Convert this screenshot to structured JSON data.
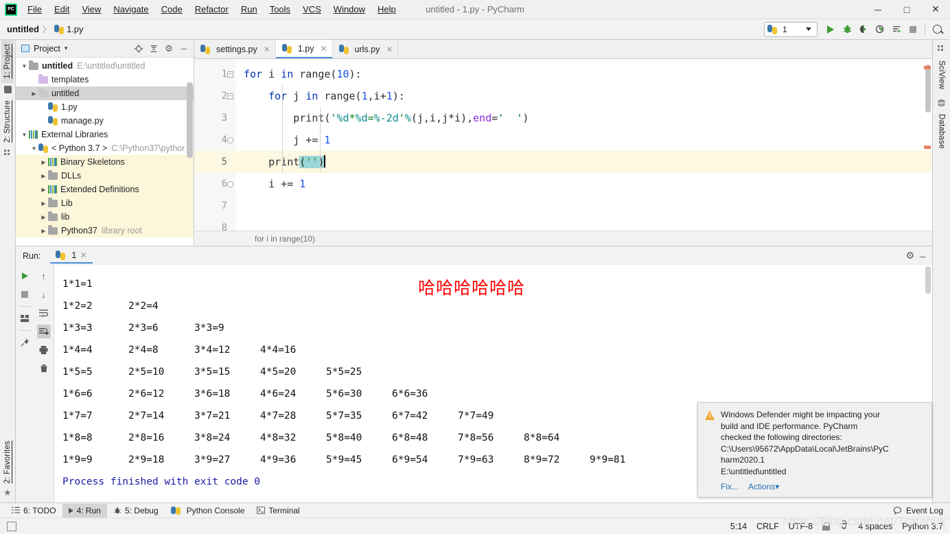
{
  "window": {
    "title": "untitled - 1.py - PyCharm",
    "logo": "pycharm-logo",
    "minimize": "─",
    "maximize": "□",
    "close": "✕"
  },
  "menubar": {
    "items": [
      "File",
      "Edit",
      "View",
      "Navigate",
      "Code",
      "Refactor",
      "Run",
      "Tools",
      "VCS",
      "Window",
      "Help"
    ]
  },
  "breadcrumb": {
    "project": "untitled",
    "separator": "〉",
    "file": "1.py"
  },
  "toolbar": {
    "run_config": "1",
    "run_button": "run-icon",
    "debug_button": "debug-icon",
    "coverage_button": "coverage-icon",
    "profile_button": "profile-icon",
    "showcmd_button": "show-command-icon",
    "stop_button": "stop-icon",
    "search_button": "search-icon"
  },
  "left_stripe": {
    "tabs": [
      {
        "label": "1: Project",
        "active": true,
        "icon": "project-icon"
      },
      {
        "label": "2: Structure",
        "active": false,
        "icon": "structure-icon"
      }
    ],
    "bottom_tab": {
      "label": "2: Favorites",
      "icon": "star-icon"
    }
  },
  "right_stripe": {
    "tabs": [
      {
        "label": "SciView",
        "icon": "sciview-icon"
      },
      {
        "label": "Database",
        "icon": "database-icon"
      }
    ]
  },
  "project_panel": {
    "title": "Project",
    "dropdown": "▾",
    "icons": [
      "locate-icon",
      "collapse-all-icon",
      "gear-icon",
      "hide-icon"
    ],
    "tree": [
      {
        "indent": 0,
        "arrow": "open",
        "icon": "folder",
        "name": "untitled",
        "bold": true,
        "path": "E:\\untitled\\untitled",
        "state": "normal"
      },
      {
        "indent": 1,
        "arrow": "none",
        "icon": "folder-purple",
        "name": "templates",
        "bold": false,
        "path": "",
        "state": "normal"
      },
      {
        "indent": 1,
        "arrow": "closed",
        "icon": "folder-light",
        "name": "untitled",
        "bold": false,
        "path": "",
        "state": "selected"
      },
      {
        "indent": 2,
        "arrow": "none",
        "icon": "python-file",
        "name": "1.py",
        "bold": false,
        "path": "",
        "state": "normal"
      },
      {
        "indent": 2,
        "arrow": "none",
        "icon": "python-file",
        "name": "manage.py",
        "bold": false,
        "path": "",
        "state": "normal"
      },
      {
        "indent": 0,
        "arrow": "open",
        "icon": "library",
        "name": "External Libraries",
        "bold": false,
        "path": "",
        "state": "normal"
      },
      {
        "indent": 1,
        "arrow": "open",
        "icon": "python-logo",
        "name": "< Python 3.7 >",
        "bold": false,
        "path": "C:\\Python37\\pythor",
        "state": "normal"
      },
      {
        "indent": 2,
        "arrow": "closed",
        "icon": "library",
        "name": "Binary Skeletons",
        "bold": false,
        "path": "",
        "state": "highlight"
      },
      {
        "indent": 2,
        "arrow": "closed",
        "icon": "folder",
        "name": "DLLs",
        "bold": false,
        "path": "",
        "state": "highlight"
      },
      {
        "indent": 2,
        "arrow": "closed",
        "icon": "library",
        "name": "Extended Definitions",
        "bold": false,
        "path": "",
        "state": "highlight"
      },
      {
        "indent": 2,
        "arrow": "closed",
        "icon": "folder",
        "name": "Lib",
        "bold": false,
        "path": "",
        "state": "highlight"
      },
      {
        "indent": 2,
        "arrow": "closed",
        "icon": "folder",
        "name": "lib",
        "bold": false,
        "path": "",
        "state": "highlight"
      },
      {
        "indent": 2,
        "arrow": "closed",
        "icon": "folder",
        "name": "Python37",
        "bold": false,
        "path": "library root",
        "state": "highlight"
      }
    ]
  },
  "editor": {
    "tabs": [
      {
        "label": "settings.py",
        "active": false,
        "close": "✕"
      },
      {
        "label": "1.py",
        "active": true,
        "close": "✕"
      },
      {
        "label": "urls.py",
        "active": false,
        "close": "✕"
      }
    ],
    "line_numbers": [
      "1",
      "2",
      "3",
      "4",
      "5",
      "6",
      "7",
      "8"
    ],
    "current_line": 5,
    "lines": [
      {
        "n": 1,
        "text": "for i in range(10):"
      },
      {
        "n": 2,
        "text": "    for j in range(1,i+1):"
      },
      {
        "n": 3,
        "text": "        print('%d*%d=%-2d'%(j,i,j*i),end='  ')"
      },
      {
        "n": 4,
        "text": "        j += 1"
      },
      {
        "n": 5,
        "text": "    print('')"
      },
      {
        "n": 6,
        "text": "    i += 1"
      },
      {
        "n": 7,
        "text": ""
      },
      {
        "n": 8,
        "text": ""
      }
    ],
    "breadcrumb_bottom": "for i in range(10)"
  },
  "run_window": {
    "label": "Run:",
    "tab_name": "1",
    "tab_close": "✕",
    "gear": "gear-icon",
    "hide": "minimize-icon",
    "tools_left": [
      "rerun-icon",
      "stop-icon",
      "layout-icon",
      "pin-icon"
    ],
    "tools_right": [
      "up-icon",
      "down-icon",
      "soft-wrap-icon",
      "scroll-end-icon",
      "print-icon",
      "clear-icon"
    ],
    "console_rows": [
      [
        "1*1=1"
      ],
      [
        "1*2=2",
        "2*2=4"
      ],
      [
        "1*3=3",
        "2*3=6",
        "3*3=9"
      ],
      [
        "1*4=4",
        "2*4=8",
        "3*4=12",
        "4*4=16"
      ],
      [
        "1*5=5",
        "2*5=10",
        "3*5=15",
        "4*5=20",
        "5*5=25"
      ],
      [
        "1*6=6",
        "2*6=12",
        "3*6=18",
        "4*6=24",
        "5*6=30",
        "6*6=36"
      ],
      [
        "1*7=7",
        "2*7=14",
        "3*7=21",
        "4*7=28",
        "5*7=35",
        "6*7=42",
        "7*7=49"
      ],
      [
        "1*8=8",
        "2*8=16",
        "3*8=24",
        "4*8=32",
        "5*8=40",
        "6*8=48",
        "7*8=56",
        "8*8=64"
      ],
      [
        "1*9=9",
        "2*9=18",
        "3*9=27",
        "4*9=36",
        "5*9=45",
        "6*9=54",
        "7*9=63",
        "8*9=72",
        "9*9=81"
      ]
    ],
    "red_text": "哈哈哈哈哈哈",
    "red_color": "#ff0000",
    "process_finished": "Process finished with exit code 0"
  },
  "notification": {
    "icon": "warning-icon",
    "line1": "Windows Defender might be impacting your",
    "line2": "build and IDE performance. PyCharm",
    "line3": "checked the following directories:",
    "line4": "C:\\Users\\95672\\AppData\\Local\\JetBrains\\PyC",
    "line5": "harm2020.1",
    "line6": "E:\\untitled\\untitled",
    "fix_label": "Fix...",
    "actions_label": "Actions",
    "actions_caret": "▾"
  },
  "bottom_bar": {
    "buttons": [
      {
        "label": "6: TODO",
        "icon": "todo-icon",
        "active": false
      },
      {
        "label": "4: Run",
        "icon": "run-icon",
        "active": true
      },
      {
        "label": "5: Debug",
        "icon": "debug-icon",
        "active": false
      },
      {
        "label": "Python Console",
        "icon": "python-icon",
        "active": false
      },
      {
        "label": "Terminal",
        "icon": "terminal-icon",
        "active": false
      }
    ],
    "event_log": "Event Log",
    "event_log_icon": "balloon-icon"
  },
  "status_bar": {
    "caret_position": "5:14",
    "line_separator": "CRLF",
    "encoding": "UTF-8",
    "lock_icon": "lock-icon",
    "hat_icon": "hector-icon",
    "indent": "4 spaces",
    "interpreter": "Python 3.7",
    "left_icon": "memory-icon"
  },
  "watermark": "https://blog.csdn.net/Tratanus"
}
